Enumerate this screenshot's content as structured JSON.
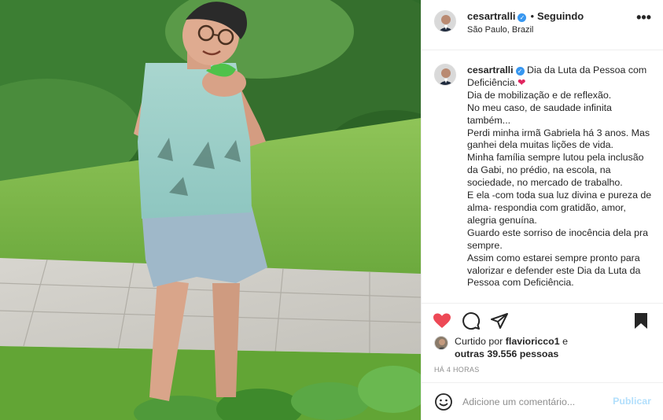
{
  "post": {
    "photo_description_icon": "photo",
    "author": {
      "username": "cesartralli",
      "verified": true,
      "avatar_icon": "profile-avatar"
    },
    "header": {
      "dot": "•",
      "follow_status": "Seguindo",
      "location": "São Paulo, Brazil",
      "more_icon": "more-horizontal-icon",
      "more_label": "•••"
    },
    "caption": {
      "username": "cesartralli",
      "text": "Dia da Luta da Pessoa com Deficiência.",
      "heart": "❤",
      "body": "Dia de mobilização e de reflexão.\nNo meu caso, de saudade infinita também...\nPerdi minha irmã Gabriela há 3 anos. Mas ganhei dela muitas lições de vida.\nMinha família sempre lutou pela inclusão da Gabi, no prédio, na escola, na sociedade, no mercado de trabalho.\nE ela -com toda sua luz divina e pureza de alma- respondia com gratidão, amor, alegria genuína.\nGuardo este sorriso de inocência dela pra sempre.\nAssim como estarei sempre pronto para valorizar e defender este Dia da Luta da Pessoa com Deficiência."
    },
    "actions": {
      "like_icon": "heart-filled-icon",
      "comment_icon": "comment-icon",
      "share_icon": "paper-plane-icon",
      "save_icon": "bookmark-filled-icon",
      "like_color": "#ed4956"
    },
    "likes": {
      "prefix": "Curtido por",
      "user": "flavioricco1",
      "connector": "e",
      "others_prefix": "outras",
      "count": "39.556",
      "suffix": "pessoas"
    },
    "timestamp": "HÁ 4 HORAS",
    "comment": {
      "placeholder": "Adicione um comentário...",
      "publish_label": "Publicar",
      "emoji_icon": "smiley-icon"
    }
  }
}
